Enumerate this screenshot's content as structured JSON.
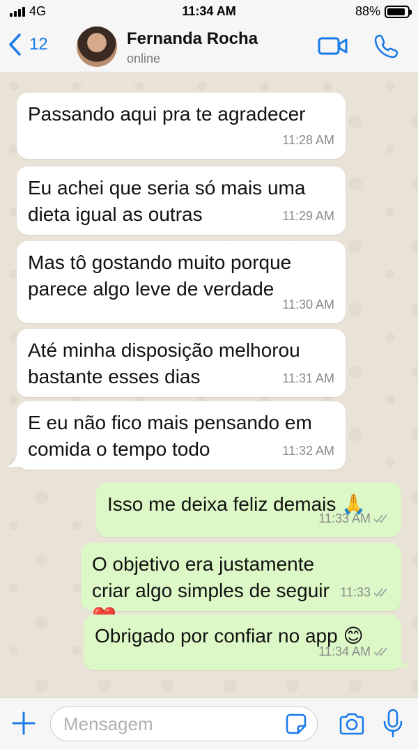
{
  "status_bar": {
    "carrier": "4G",
    "time": "11:34 AM",
    "battery_percent": "88%",
    "battery_level": 0.88
  },
  "header": {
    "back_count": "12",
    "contact_name": "Fernanda Rocha",
    "contact_status": "online",
    "accent_color": "#1a7be8",
    "icons": [
      "chevron-left-icon",
      "video-call-icon",
      "phone-call-icon"
    ]
  },
  "messages": [
    {
      "direction": "incoming",
      "text": "Passando aqui pra te agradecer",
      "time": "11:28 AM"
    },
    {
      "direction": "incoming",
      "text": "Eu achei que seria só mais uma dieta igual as outras",
      "time": "11:29 AM"
    },
    {
      "direction": "incoming",
      "text": "Mas tô gostando muito porque parece algo leve de verdade",
      "time": "11:30 AM"
    },
    {
      "direction": "incoming",
      "text": "Até minha disposição melhorou bastante esses dias",
      "time": "11:31 AM"
    },
    {
      "direction": "incoming",
      "text": "E eu não fico mais pensando em comida o tempo todo",
      "time": "11:32 AM"
    },
    {
      "direction": "outgoing",
      "text": "Isso me deixa feliz demais 🙏",
      "time": "11:33 AM"
    },
    {
      "direction": "outgoing",
      "text": "O objetivo era justamente criar algo simples de seguir ❤️",
      "time": "11:33"
    },
    {
      "direction": "outgoing",
      "text": "Obrigado por confiar no app 😊",
      "time": "11:34 AM"
    }
  ],
  "colors": {
    "incoming_bubble": "#ffffff",
    "outgoing_bubble": "#dcf8c6",
    "chat_background": "#e9e2d6"
  },
  "composer": {
    "placeholder": "Mensagem",
    "value": ""
  }
}
